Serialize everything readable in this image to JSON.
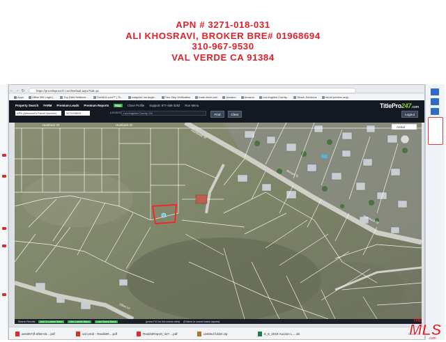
{
  "listing": {
    "apn_line": "APN # 3271-018-031",
    "broker_line": "ALI KHOSRAVI, BROKER BRE# 01968694",
    "phone_line": "310-967-9530",
    "location_line": "VAL VERDE CA  91384"
  },
  "browser": {
    "url": "https://pro.titlepro247.com/Default.aspx?tab=pc",
    "bookmarks": [
      "Apps",
      "Office 365 Login |...",
      "Top Debt Settleme...",
      "TheMLS.com™ | Th...",
      "craigslist: los angel...",
      "Two-Step Verification",
      "trade-fever.com",
      "Amazon",
      "Amazon",
      "Los Angeles County...",
      "Hirsch Solutions",
      "InkJet printers angl..."
    ]
  },
  "app": {
    "tabs": [
      "Property Search",
      "FARM",
      "Premium Leads",
      "Premium Reports"
    ],
    "active_tab": "Map",
    "links": [
      "Close Profile",
      "Support: 877-456-3282",
      "Run Menu"
    ],
    "search_type": "APN (Assessor's Parcel Number)",
    "search_value": "3271018031",
    "location_label": "LOCATION",
    "location_value": "Los Angeles County, CA",
    "find_label": "Find",
    "clear_label": "Clear",
    "logout_label": "Logout",
    "logo_text": "TitlePro",
    "logo_num": "247",
    "logo_suffix": ".com"
  },
  "map": {
    "street_labels": [
      "Humbock St",
      "Humbock St",
      "Humbock St",
      "Arroyo St",
      "Humbock St",
      "Olive Ln"
    ],
    "subject_parcel": "3271-018-031",
    "aerial_label": "Aerial"
  },
  "statusbar": {
    "items": [
      "Search Results",
      "Add To Labels Batch",
      "View Labels Batch",
      "Load Saved Batch",
      "(press F11 for full-screen view)",
      "(5 Items in current batch reports)"
    ]
  },
  "downloads": {
    "items": [
      {
        "name": "ae0d673f-ef58-46....pdf",
        "type": "pdf"
      },
      {
        "name": "val verdi - RealistR....pdf",
        "type": "pdf"
      },
      {
        "name": "RealistReport_327....pdf",
        "type": "pdf"
      },
      {
        "name": "untitled folder.zip",
        "type": "zip"
      },
      {
        "name": "8_8_2018 Auction L....xls",
        "type": "xls"
      }
    ],
    "show_all": "Show all"
  },
  "watermark": {
    "text": "THE MLS.com"
  },
  "colors": {
    "heading_red": "#e0202a",
    "parcel_highlight": "#ff1f1f",
    "parcel_lines": "#ffffff",
    "app_bar": "#141820"
  }
}
